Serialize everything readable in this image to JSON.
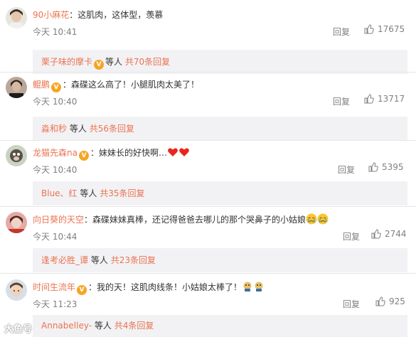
{
  "comments": [
    {
      "username": "90小麻花",
      "colon": "：",
      "text": "这肌肉，这体型，羡慕",
      "time": "今天 10:41",
      "reply_label": "回复",
      "likes": "17675",
      "sub_user": "栗子味的摩卡",
      "sub_mid": "等人",
      "sub_count": "共70条回复"
    },
    {
      "username": "鲲鹏",
      "colon": "：",
      "text": "森碟这么高了！小腿肌肉太美了！",
      "time": "今天 10:40",
      "reply_label": "回复",
      "likes": "13717",
      "sub_user": "淼和秒",
      "sub_mid": "等人",
      "sub_count": "共56条回复"
    },
    {
      "username": "龙猫先森na",
      "colon": "：",
      "text": "妹妹长的好快啊…",
      "time": "今天 10:40",
      "reply_label": "回复",
      "likes": "5395",
      "sub_user": "Blue、红",
      "sub_mid": "等人",
      "sub_count": "共35条回复"
    },
    {
      "username": "向日葵的天空",
      "colon": "：",
      "text": "森碟妹妹真棒，还记得爸爸去哪儿的那个哭鼻子的小姑娘",
      "time": "今天 10:44",
      "reply_label": "回复",
      "likes": "2744",
      "sub_user": "逢考必胜_谭",
      "sub_mid": "等人",
      "sub_count": "共23条回复"
    },
    {
      "username": "时间生流年",
      "colon": "：",
      "text": "我的天！这肌肉线条！小姑娘太棒了！",
      "time": "今天 11:23",
      "reply_label": "回复",
      "likes": "925",
      "sub_user": "Annabelley-",
      "sub_mid": "等人",
      "sub_count": "共4条回复"
    }
  ],
  "watermark": "大鱼号",
  "colors": {
    "username": "#eb7350",
    "meta": "#808080",
    "sub_bg": "#f2f2f5",
    "badge": "#f5a623",
    "heart": "#e8261d"
  },
  "icons": {
    "like": "thumbs-up-icon",
    "badge": "vip-badge-icon",
    "heart": "heart-emoji-icon",
    "cry": "crying-face-emoji-icon",
    "doge": "doge-emoji-icon"
  }
}
